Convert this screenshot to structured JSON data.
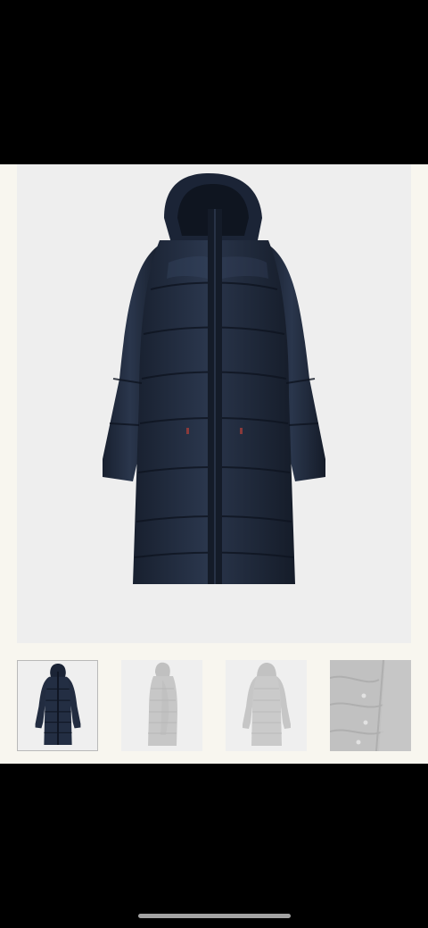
{
  "product": {
    "main_image_icon": "hooded-long-puffer-coat-image",
    "main_image_color": "#1f2a3d"
  },
  "thumbnails": [
    {
      "icon": "coat-front-thumbnail-icon",
      "selected": true
    },
    {
      "icon": "coat-side-thumbnail-icon",
      "selected": false
    },
    {
      "icon": "coat-back-thumbnail-icon",
      "selected": false
    },
    {
      "icon": "coat-fabric-detail-thumbnail-icon",
      "selected": false
    }
  ],
  "colors": {
    "background": "#f8f6ef",
    "image_backdrop": "#eeeeee",
    "coat_navy": "#1f2a3d",
    "thumb_border": "#b9b9b9"
  }
}
